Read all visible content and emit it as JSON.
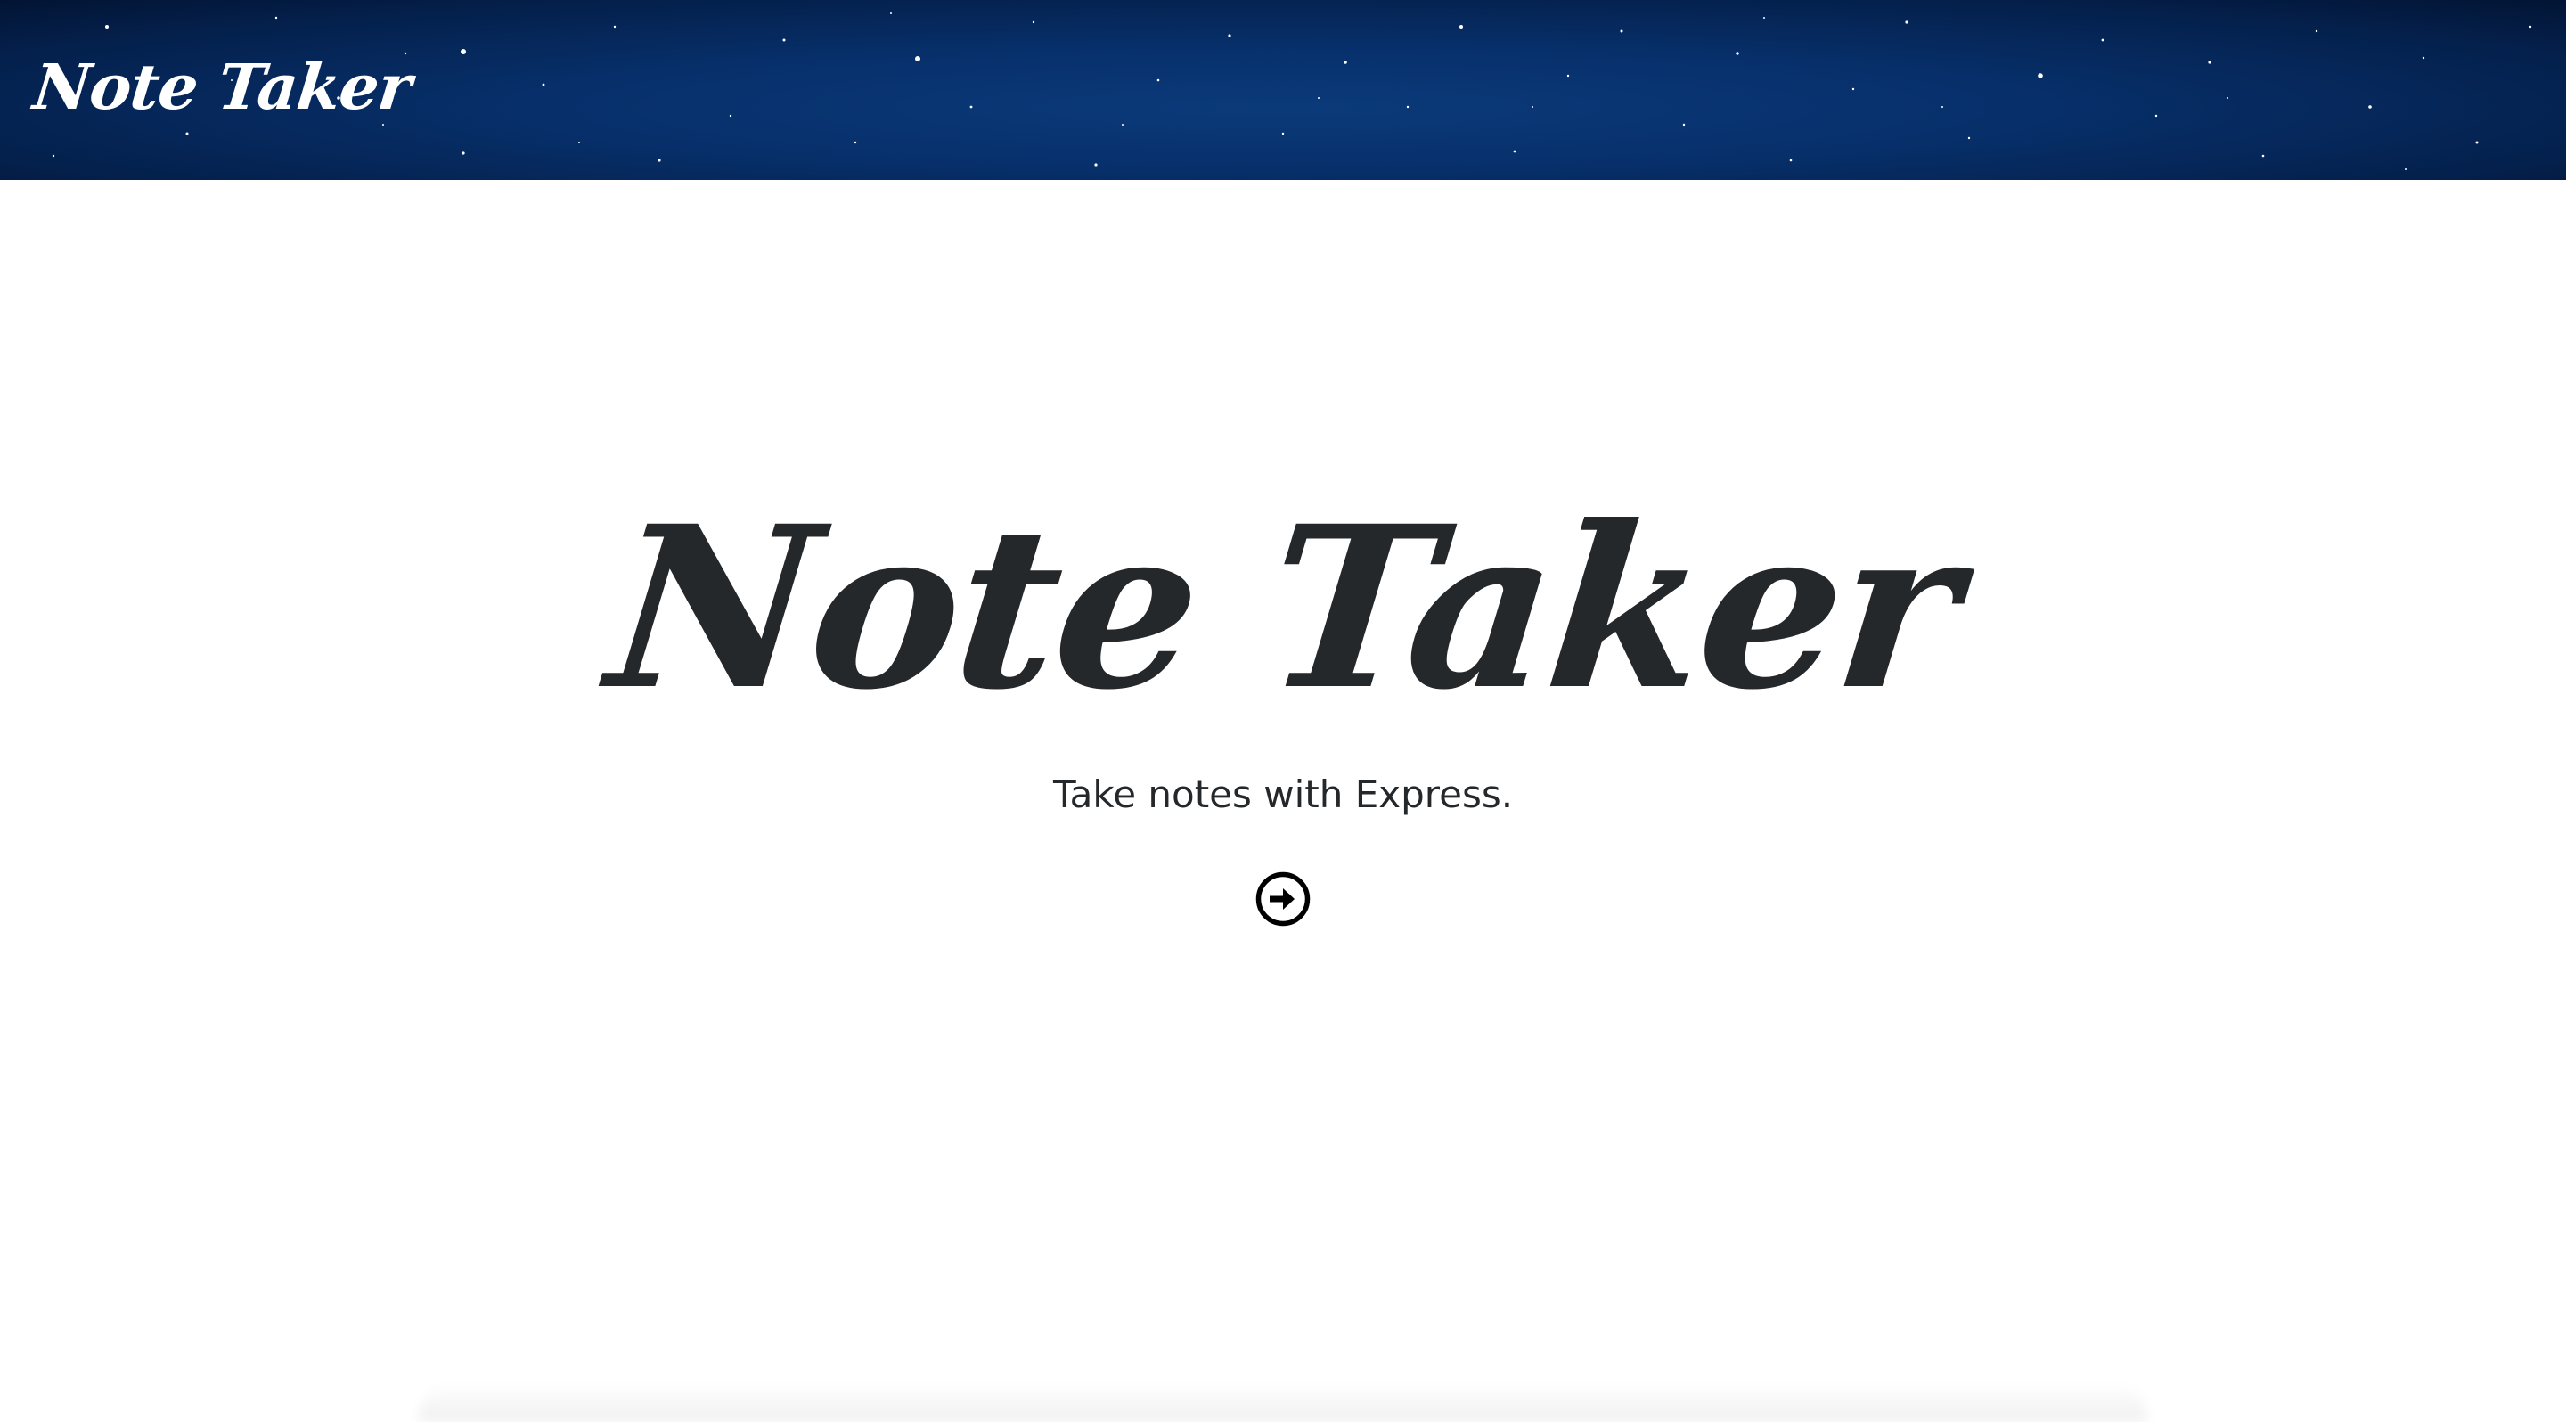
{
  "navbar": {
    "brand": "Note Taker",
    "background_color": "#07306b"
  },
  "hero": {
    "title": "Note Taker",
    "subtitle": "Take notes with Express.",
    "text_color": "#25282b",
    "action_icon": "arrow-circle-right-icon"
  }
}
